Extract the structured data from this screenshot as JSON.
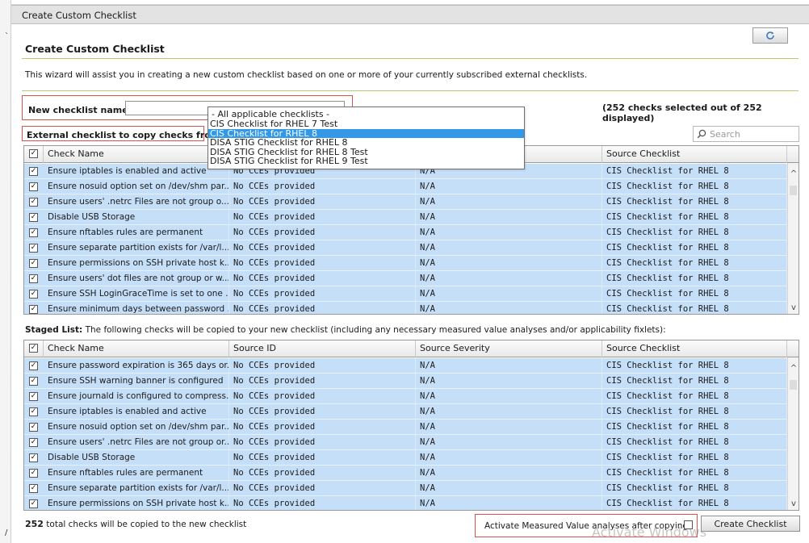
{
  "window": {
    "title": "Create Custom Checklist",
    "heading": "Create Custom Checklist",
    "intro": "This wizard will assist you in creating a new custom checklist based on one or more of your currently subscribed external checklists."
  },
  "form": {
    "name_label": "New checklist name:",
    "name_value": "",
    "external_label": "External checklist to copy checks from:",
    "counts_text": "(252  checks selected out of 252 displayed)",
    "search_placeholder": "Search"
  },
  "dropdown": {
    "items": [
      "- All applicable checklists -",
      "CIS Checklist for RHEL 7 Test",
      "CIS Checklist for RHEL 8",
      "DISA STIG Checklist for RHEL 8",
      "DISA STIG Checklist for RHEL 8 Test",
      "DISA STIG Checklist for RHEL 9 Test"
    ],
    "selected_index": 2
  },
  "top_grid": {
    "columns": [
      "Check Name",
      "",
      "",
      "Source Checklist"
    ],
    "rows": [
      [
        "Ensure iptables is enabled and active",
        "No CCEs provided",
        "N/A",
        "CIS Checklist for RHEL 8"
      ],
      [
        "Ensure nosuid option set on /dev/shm par...",
        "No CCEs provided",
        "N/A",
        "CIS Checklist for RHEL 8"
      ],
      [
        "Ensure users' .netrc Files are not group o...",
        "No CCEs provided",
        "N/A",
        "CIS Checklist for RHEL 8"
      ],
      [
        "Disable USB Storage",
        "No CCEs provided",
        "N/A",
        "CIS Checklist for RHEL 8"
      ],
      [
        "Ensure nftables rules are permanent",
        "No CCEs provided",
        "N/A",
        "CIS Checklist for RHEL 8"
      ],
      [
        "Ensure separate partition exists for /var/l...",
        "No CCEs provided",
        "N/A",
        "CIS Checklist for RHEL 8"
      ],
      [
        "Ensure permissions on SSH private host k...",
        "No CCEs provided",
        "N/A",
        "CIS Checklist for RHEL 8"
      ],
      [
        "Ensure users' dot files are not group or w...",
        "No CCEs provided",
        "N/A",
        "CIS Checklist for RHEL 8"
      ],
      [
        "Ensure SSH LoginGraceTime is set to one ...",
        "No CCEs provided",
        "N/A",
        "CIS Checklist for RHEL 8"
      ],
      [
        "Ensure minimum days between password ...",
        "No CCEs provided",
        "N/A",
        "CIS Checklist for RHEL 8"
      ]
    ]
  },
  "staged": {
    "label": "Staged List:",
    "description": " The following checks will be copied to your new checklist (including any necessary measured value analyses and/or applicability fixlets):"
  },
  "bottom_grid": {
    "columns": [
      "Check Name",
      "Source ID",
      "Source Severity",
      "Source Checklist"
    ],
    "rows": [
      [
        "Ensure password expiration is 365 days or...",
        "No CCEs provided",
        "N/A",
        "CIS Checklist for RHEL 8"
      ],
      [
        "Ensure SSH warning banner is configured",
        "No CCEs provided",
        "N/A",
        "CIS Checklist for RHEL 8"
      ],
      [
        "Ensure journald is configured to compress...",
        "No CCEs provided",
        "N/A",
        "CIS Checklist for RHEL 8"
      ],
      [
        "Ensure iptables is enabled and active",
        "No CCEs provided",
        "N/A",
        "CIS Checklist for RHEL 8"
      ],
      [
        "Ensure nosuid option set on /dev/shm par...",
        "No CCEs provided",
        "N/A",
        "CIS Checklist for RHEL 8"
      ],
      [
        "Ensure users' .netrc Files are not group or...",
        "No CCEs provided",
        "N/A",
        "CIS Checklist for RHEL 8"
      ],
      [
        "Disable USB Storage",
        "No CCEs provided",
        "N/A",
        "CIS Checklist for RHEL 8"
      ],
      [
        "Ensure nftables rules are permanent",
        "No CCEs provided",
        "N/A",
        "CIS Checklist for RHEL 8"
      ],
      [
        "Ensure separate partition exists for /var/l...",
        "No CCEs provided",
        "N/A",
        "CIS Checklist for RHEL 8"
      ],
      [
        "Ensure permissions on SSH private host k...",
        "No CCEs provided",
        "N/A",
        "CIS Checklist for RHEL 8"
      ]
    ]
  },
  "footer": {
    "total_count": "252",
    "total_text": "  total checks will be copied to the new checklist",
    "activate_label": "Activate Measured Value analyses after copying",
    "create_button": "Create Checklist",
    "watermark": "Activate Windows"
  },
  "colors": {
    "row_bg": "#c6dff8",
    "selected_option": "#3399e6",
    "highlight_border": "#d9534f",
    "divider": "#b5cc72"
  }
}
